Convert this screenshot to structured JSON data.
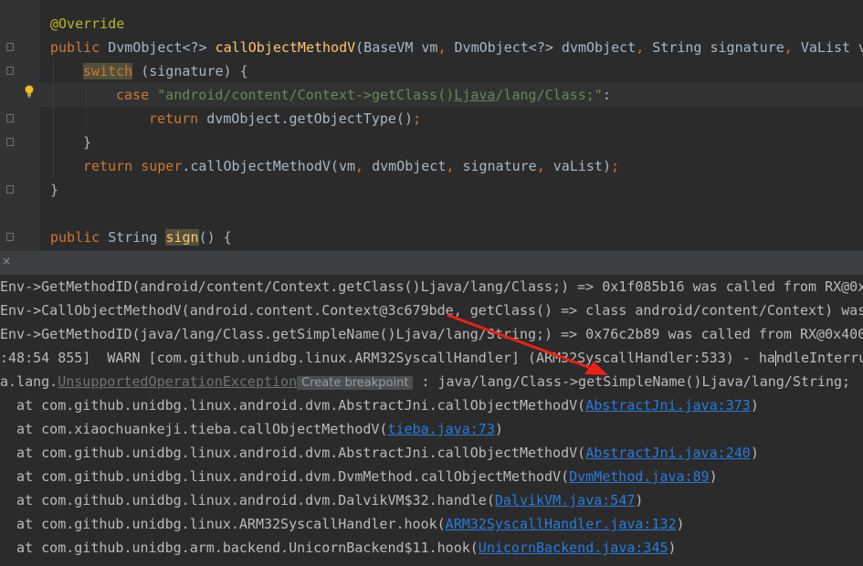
{
  "editor": {
    "lines": [
      {
        "parts": [
          {
            "t": "@Override",
            "c": "ann"
          }
        ]
      },
      {
        "parts": [
          {
            "t": "public ",
            "c": "kw"
          },
          {
            "t": "DvmObject<?> "
          },
          {
            "t": "callObjectMethodV",
            "c": "fn"
          },
          {
            "t": "(BaseVM vm"
          },
          {
            "t": ", ",
            "c": "kw"
          },
          {
            "t": "DvmObject<?> dvmObject"
          },
          {
            "t": ", ",
            "c": "kw"
          },
          {
            "t": "String signature"
          },
          {
            "t": ", ",
            "c": "kw"
          },
          {
            "t": "VaList v"
          }
        ]
      },
      {
        "parts": [
          {
            "t": "switch",
            "c": "kw hl-yellow"
          },
          {
            "t": " (signature) {"
          }
        ]
      },
      {
        "parts": [
          {
            "t": "case ",
            "c": "kw"
          },
          {
            "t": "\"android/content/Context->getClass()",
            "c": "str"
          },
          {
            "t": "Ljava",
            "c": "str undln"
          },
          {
            "t": "/lang/Class;\"",
            "c": "str"
          },
          {
            "t": ":"
          }
        ]
      },
      {
        "parts": [
          {
            "t": "return ",
            "c": "kw"
          },
          {
            "t": "dvmObject.getObjectType()"
          },
          {
            "t": ";",
            "c": "kw"
          }
        ]
      },
      {
        "parts": [
          {
            "t": "}"
          }
        ]
      },
      {
        "parts": [
          {
            "t": "return ",
            "c": "kw"
          },
          {
            "t": "super",
            "c": "kw"
          },
          {
            "t": ".callObjectMethodV(vm"
          },
          {
            "t": ", ",
            "c": "kw"
          },
          {
            "t": "dvmObject"
          },
          {
            "t": ", ",
            "c": "kw"
          },
          {
            "t": "signature"
          },
          {
            "t": ", ",
            "c": "kw"
          },
          {
            "t": "vaList)"
          },
          {
            "t": ";",
            "c": "kw"
          }
        ]
      },
      {
        "parts": [
          {
            "t": "}"
          }
        ]
      },
      {
        "parts": []
      },
      {
        "parts": [
          {
            "t": "public ",
            "c": "kw"
          },
          {
            "t": "String "
          },
          {
            "t": "sign",
            "c": "fn hl-yellow"
          },
          {
            "t": "() {"
          }
        ]
      }
    ]
  },
  "console": {
    "close_label": "×",
    "tooltip": "Create breakpoint",
    "lines": [
      {
        "parts": [
          {
            "t": "Env->GetMethodID(android/content/Context.getClass()Ljava/lang/Class;) => 0x1f085b16 was called from RX@0x4"
          }
        ]
      },
      {
        "parts": [
          {
            "t": "Env->CallObjectMethodV(android.content.Context@3c679bde, getClass() => class android/content/Context) was"
          }
        ]
      },
      {
        "parts": [
          {
            "t": "Env->GetMethodID(java/lang/Class.getSimpleName()Ljava/lang/String;) => 0x76c2b89 was called from RX@0x4004"
          }
        ]
      },
      {
        "parts": [
          {
            "t": ":48:54 855]  WARN [com.github.unidbg.linux.ARM32SyscallHandler] (ARM32SyscallHandler:533) - ha"
          },
          {
            "t": "",
            "c": "caret"
          },
          {
            "t": "ndleInterrup"
          }
        ]
      },
      {
        "parts": [
          {
            "t": "a.lang."
          },
          {
            "t": "UnsupportedOperationException",
            "c": "exc-link"
          },
          {
            "t": "Create breakpoint",
            "c": "tip"
          },
          {
            "t": " : java/lang/Class->getSimpleName()Ljava/lang/String;"
          }
        ]
      },
      {
        "parts": [
          {
            "t": "  at com.github.unidbg.linux.android.dvm.AbstractJni.callObjectMethodV("
          },
          {
            "t": "AbstractJni.java:373",
            "c": "link"
          },
          {
            "t": ")"
          }
        ]
      },
      {
        "parts": [
          {
            "t": "  at com.xiaochuankeji.tieba.callObjectMethodV("
          },
          {
            "t": "tieba.java:73",
            "c": "link"
          },
          {
            "t": ")"
          }
        ]
      },
      {
        "parts": [
          {
            "t": "  at com.github.unidbg.linux.android.dvm.AbstractJni.callObjectMethodV("
          },
          {
            "t": "AbstractJni.java:240",
            "c": "link"
          },
          {
            "t": ")"
          }
        ]
      },
      {
        "parts": [
          {
            "t": "  at com.github.unidbg.linux.android.dvm.DvmMethod.callObjectMethodV("
          },
          {
            "t": "DvmMethod.java:89",
            "c": "link"
          },
          {
            "t": ")"
          }
        ]
      },
      {
        "parts": [
          {
            "t": "  at com.github.unidbg.linux.android.dvm.DalvikVM$32.handle("
          },
          {
            "t": "DalvikVM.java:547",
            "c": "link"
          },
          {
            "t": ")"
          }
        ]
      },
      {
        "parts": [
          {
            "t": "  at com.github.unidbg.linux.ARM32SyscallHandler.hook("
          },
          {
            "t": "ARM32SyscallHandler.java:132",
            "c": "link"
          },
          {
            "t": ")"
          }
        ]
      },
      {
        "parts": [
          {
            "t": "  at com.github.unidbg.arm.backend.UnicornBackend$11.hook("
          },
          {
            "t": "UnicornBackend.java:345",
            "c": "link"
          },
          {
            "t": ")"
          }
        ]
      }
    ]
  },
  "colors": {
    "annotation_arrow": "#e8211a",
    "link": "#287bde",
    "keyword": "#cc7832",
    "function": "#ffc66d",
    "string": "#6a8759"
  }
}
